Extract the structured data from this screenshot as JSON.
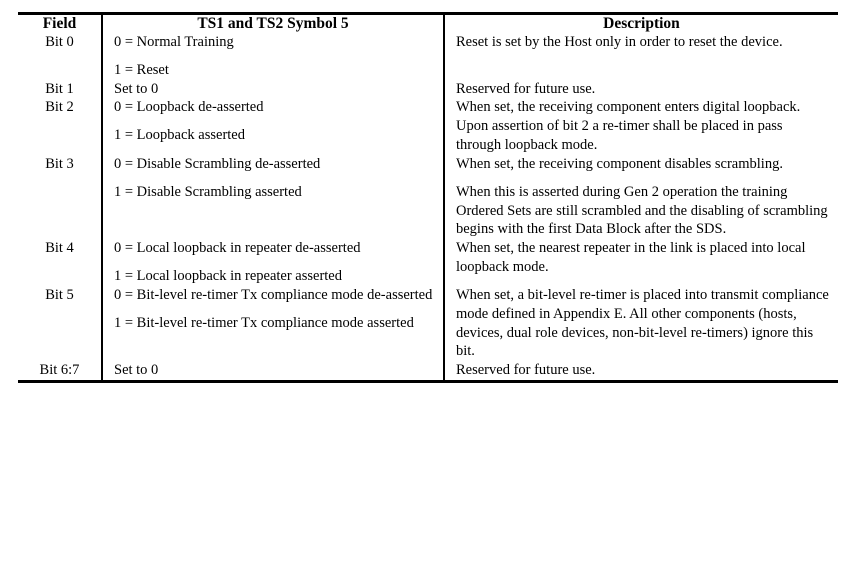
{
  "table": {
    "caption": "",
    "columns": [
      {
        "key": "field",
        "label": "Field"
      },
      {
        "key": "symbol",
        "label": "TS1 and TS2 Symbol 5"
      },
      {
        "key": "description",
        "label": "Description"
      }
    ],
    "rows": [
      {
        "field": "Bit 0",
        "symbol": [
          "0 = Normal Training",
          "1 = Reset"
        ],
        "description": [
          "Reset is set by the Host only in order to reset the device."
        ]
      },
      {
        "field": "Bit 1",
        "symbol": [
          "Set to 0"
        ],
        "description": [
          "Reserved for future use."
        ]
      },
      {
        "field": "Bit 2",
        "symbol": [
          "0 = Loopback de-asserted",
          "1 = Loopback asserted"
        ],
        "description": [
          "When set, the receiving component enters digital loopback.  Upon assertion of bit 2 a re-timer shall be placed in pass through loopback mode."
        ]
      },
      {
        "field": "Bit 3",
        "symbol": [
          "0 = Disable Scrambling de-asserted",
          "1 = Disable Scrambling asserted"
        ],
        "description": [
          "When set, the receiving component disables scrambling.",
          "When this is asserted during Gen 2 operation the training Ordered Sets are still scrambled and the disabling of scrambling begins with the first Data Block after the SDS."
        ]
      },
      {
        "field": "Bit 4",
        "symbol": [
          "0 = Local loopback in repeater de-asserted",
          "1 = Local loopback in repeater asserted"
        ],
        "description": [
          "When set, the nearest repeater in the link is placed into local loopback mode."
        ]
      },
      {
        "field": "Bit 5",
        "symbol": [
          "0 = Bit-level re-timer Tx compliance mode de-asserted",
          "1 = Bit-level re-timer Tx compliance mode asserted"
        ],
        "description": [
          "When set, a bit-level re-timer is placed into transmit compliance mode defined in Appendix E.  All other components (hosts, devices, dual role devices, non-bit-level re-timers) ignore this bit."
        ]
      },
      {
        "field": "Bit 6:7",
        "symbol": [
          "Set to 0"
        ],
        "description": [
          "Reserved for future use."
        ]
      }
    ]
  },
  "style": {
    "text_color": "#000000",
    "background_color": "#ffffff",
    "rule_color": "#000000"
  }
}
